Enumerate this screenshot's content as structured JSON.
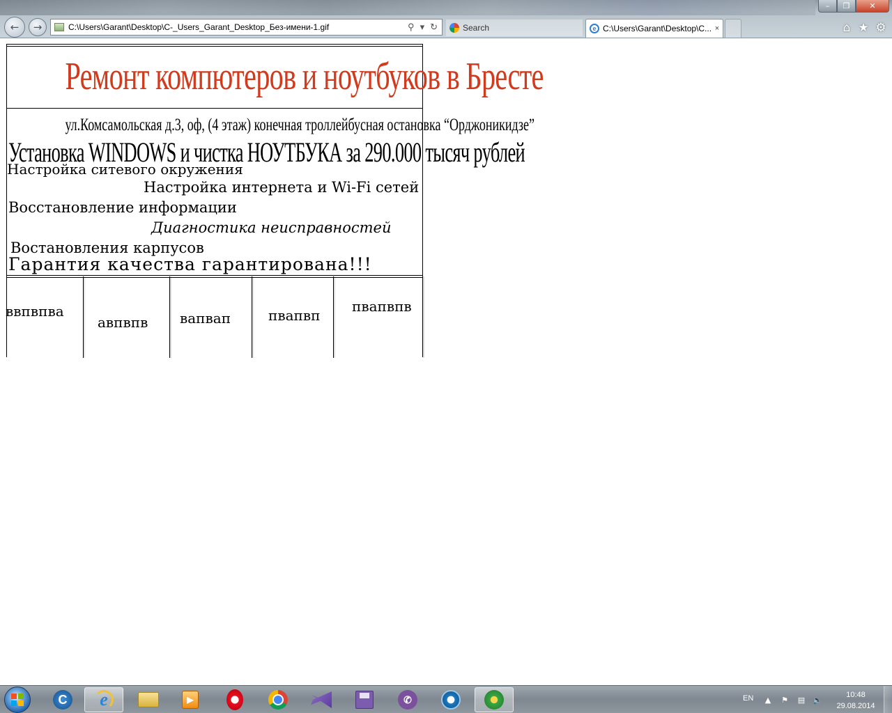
{
  "browser": {
    "address": "C:\\Users\\Garant\\Desktop\\C-_Users_Garant_Desktop_Без-имени-1.gif",
    "search_label": "Search",
    "active_tab_title": "C:\\Users\\Garant\\Desktop\\C...",
    "tab_close": "×",
    "window_controls": {
      "minimize": "–",
      "maximize": "❐",
      "close": "✕"
    },
    "icons": {
      "back": "arrow-left",
      "forward": "arrow-right",
      "home": "house",
      "favorites": "star",
      "tools": "gear"
    }
  },
  "page": {
    "title": "Ремонт компютеров и ноутбуков в Бресте",
    "title_color": "#d13a1c",
    "address_line": "ул.Комсамольская д.3, оф, (4 этаж) конечная троллейбусная остановка “Орджоникидзе”",
    "promo": "Установка WINDOWS и чистка НОУТБУКА за 290.000 тысяч рублей",
    "services": [
      "Настройка ситевого окружения",
      "Настройка интернета и Wi-Fi сетей",
      "Восстановление информации",
      "Диагностика неисправностей",
      "Востановления карпусов"
    ],
    "guarantee": "Гарантия качества гарантирована!!!",
    "cells": [
      "ввпвпва",
      "авпвпв",
      "вапвап",
      "пвапвп",
      "пвапвпв"
    ]
  },
  "taskbar": {
    "apps": [
      "start",
      "ccleaner",
      "internet-explorer",
      "file-explorer",
      "media-player",
      "opera",
      "chrome",
      "visual-studio",
      "save-app",
      "viber",
      "dial-app",
      "icq"
    ],
    "language": "EN",
    "time": "10:48",
    "date": "29.08.2014"
  }
}
